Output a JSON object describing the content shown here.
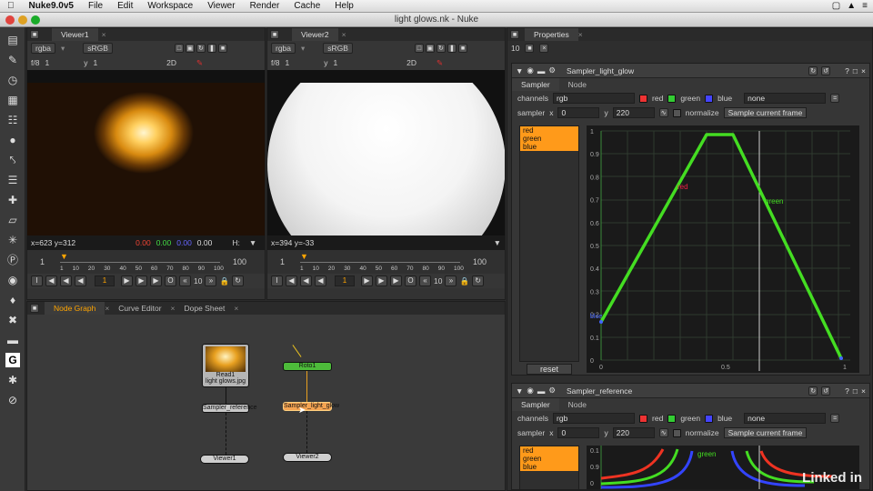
{
  "menubar": {
    "app": "Nuke9.0v5",
    "items": [
      "File",
      "Edit",
      "Workspace",
      "Viewer",
      "Render",
      "Cache",
      "Help"
    ]
  },
  "window": {
    "title": "light glows.nk - Nuke"
  },
  "viewer1": {
    "tab": "Viewer1",
    "channels": "rgba",
    "lut": "sRGB",
    "fstop": "f/8",
    "gain": "1",
    "y_label": "y",
    "y_value": "1",
    "mode": "2D",
    "coords": "x=623 y=312",
    "pixel_r": "0.00",
    "pixel_g": "0.00",
    "pixel_b": "0.00",
    "pixel_a": "0.00",
    "h_label": "H:",
    "timeline_start": "1",
    "timeline_end": "100",
    "ticks": [
      "1",
      "10",
      "20",
      "30",
      "40",
      "50",
      "60",
      "70",
      "80",
      "90",
      "100"
    ],
    "frame": "1",
    "step": "10"
  },
  "viewer2": {
    "tab": "Viewer2",
    "channels": "rgba",
    "lut": "sRGB",
    "fstop": "f/8",
    "gain": "1",
    "y_label": "y",
    "y_value": "1",
    "mode": "2D",
    "coords": "x=394 y=-33",
    "timeline_start": "1",
    "timeline_end": "100",
    "ticks": [
      "1",
      "10",
      "20",
      "30",
      "40",
      "50",
      "60",
      "70",
      "80",
      "90",
      "100"
    ],
    "frame": "1",
    "step": "10"
  },
  "bottom_tabs": {
    "node_graph": "Node Graph",
    "curve_editor": "Curve Editor",
    "dope_sheet": "Dope Sheet"
  },
  "nodes": {
    "read1": "Read1",
    "read1_file": "light glows.jpg",
    "sampler_reference": "Sampler_reference",
    "viewer1": "Viewer1",
    "roto1": "Roto1",
    "sampler_light_glow": "Sampler_light_glow",
    "viewer2": "Viewer2"
  },
  "properties": {
    "tab": "Properties",
    "count": "10",
    "panel1": {
      "name": "Sampler_light_glow",
      "tabs": [
        "Sampler",
        "Node"
      ],
      "channels_label": "channels",
      "channels": "rgb",
      "red": "red",
      "green": "green",
      "blue": "blue",
      "none": "none",
      "sampler_label": "sampler",
      "x_label": "x",
      "x_value": "0",
      "y_label": "y",
      "y_value": "220",
      "normalize": "normalize",
      "sample_button": "Sample current frame",
      "list": [
        "red",
        "green",
        "blue"
      ],
      "reset": "reset",
      "y_ticks": [
        "1",
        "0.9",
        "0.8",
        "0.7",
        "0.6",
        "0.5",
        "0.4",
        "0.3",
        "0.2",
        "0.1",
        "0"
      ],
      "x_ticks": [
        "0",
        "0.5",
        "1"
      ],
      "curve_label_red": "red",
      "curve_label_green": "green",
      "curve_label_blue": "blue"
    },
    "panel2": {
      "name": "Sampler_reference",
      "tabs": [
        "Sampler",
        "Node"
      ],
      "channels_label": "channels",
      "channels": "rgb",
      "red": "red",
      "green": "green",
      "blue": "blue",
      "none": "none",
      "sampler_label": "sampler",
      "x_label": "x",
      "x_value": "0",
      "y_label": "y",
      "y_value": "220",
      "normalize": "normalize",
      "sample_button": "Sample current frame",
      "list": [
        "red",
        "green",
        "blue"
      ],
      "y_ticks": [
        "0.1",
        "0.9",
        "0"
      ],
      "curve_label": "green"
    }
  },
  "colors": {
    "accent": "#ffa500",
    "curve_green": "#44dd22",
    "curve_red": "#ee3322",
    "curve_blue": "#3344ff",
    "node_read": "#b5b5b5",
    "node_roto": "#4dbb3a",
    "node_sampler_selected": "#f5a452"
  },
  "watermark": "Linked in"
}
